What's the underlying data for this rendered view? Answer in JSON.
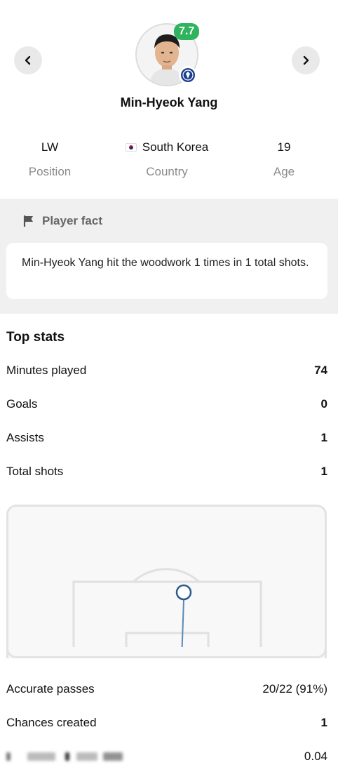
{
  "player": {
    "name": "Min-Hyeok Yang",
    "rating": "7.7",
    "position_value": "LW",
    "position_label": "Position",
    "country_value": "South Korea",
    "country_label": "Country",
    "age_value": "19",
    "age_label": "Age"
  },
  "fact": {
    "title": "Player fact",
    "text": "Min-Hyeok Yang hit the woodwork 1 times in 1 total shots."
  },
  "top_stats": {
    "title": "Top stats",
    "rows": [
      {
        "label": "Minutes played",
        "value": "74"
      },
      {
        "label": "Goals",
        "value": "0"
      },
      {
        "label": "Assists",
        "value": "1"
      },
      {
        "label": "Total shots",
        "value": "1"
      }
    ]
  },
  "more_stats": {
    "rows": [
      {
        "label": "Accurate passes",
        "value": "20/22 (91%)"
      },
      {
        "label": "Chances created",
        "value": "1"
      },
      {
        "label": "",
        "value": "0.04"
      }
    ]
  },
  "colors": {
    "rating": "#2fb35f",
    "shot_marker": "#2b5a8c",
    "fact_bg": "#f0f0f0"
  },
  "icons": {
    "prev": "chevron-left-icon",
    "next": "chevron-right-icon",
    "fact": "flag-icon"
  }
}
